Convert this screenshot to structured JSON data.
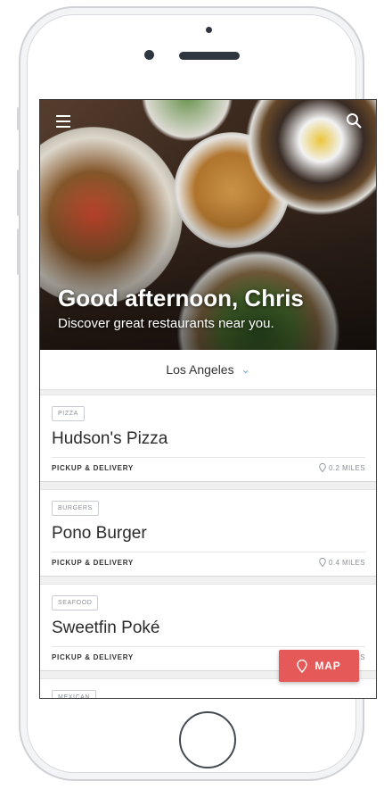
{
  "hero": {
    "greeting": "Good afternoon, Chris",
    "subtitle": "Discover great restaurants near you."
  },
  "location": {
    "city": "Los Angeles"
  },
  "restaurants": [
    {
      "category": "PIZZA",
      "name": "Hudson's Pizza",
      "service": "PICKUP & DELIVERY",
      "distance": "0.2 MILES"
    },
    {
      "category": "BURGERS",
      "name": "Pono Burger",
      "service": "PICKUP & DELIVERY",
      "distance": "0.4 MILES"
    },
    {
      "category": "SEAFOOD",
      "name": "Sweetfin Poké",
      "service": "PICKUP & DELIVERY",
      "distance": "0.4 MILES"
    },
    {
      "category": "MEXICAN",
      "name": "",
      "service": "",
      "distance": ""
    }
  ],
  "map_button": {
    "label": "MAP"
  },
  "icons": [
    "menu-icon",
    "search-icon",
    "chevron-down-icon",
    "location-pin-icon"
  ],
  "colors": {
    "accent": "#e55959",
    "chevron": "#6a9ec7"
  }
}
